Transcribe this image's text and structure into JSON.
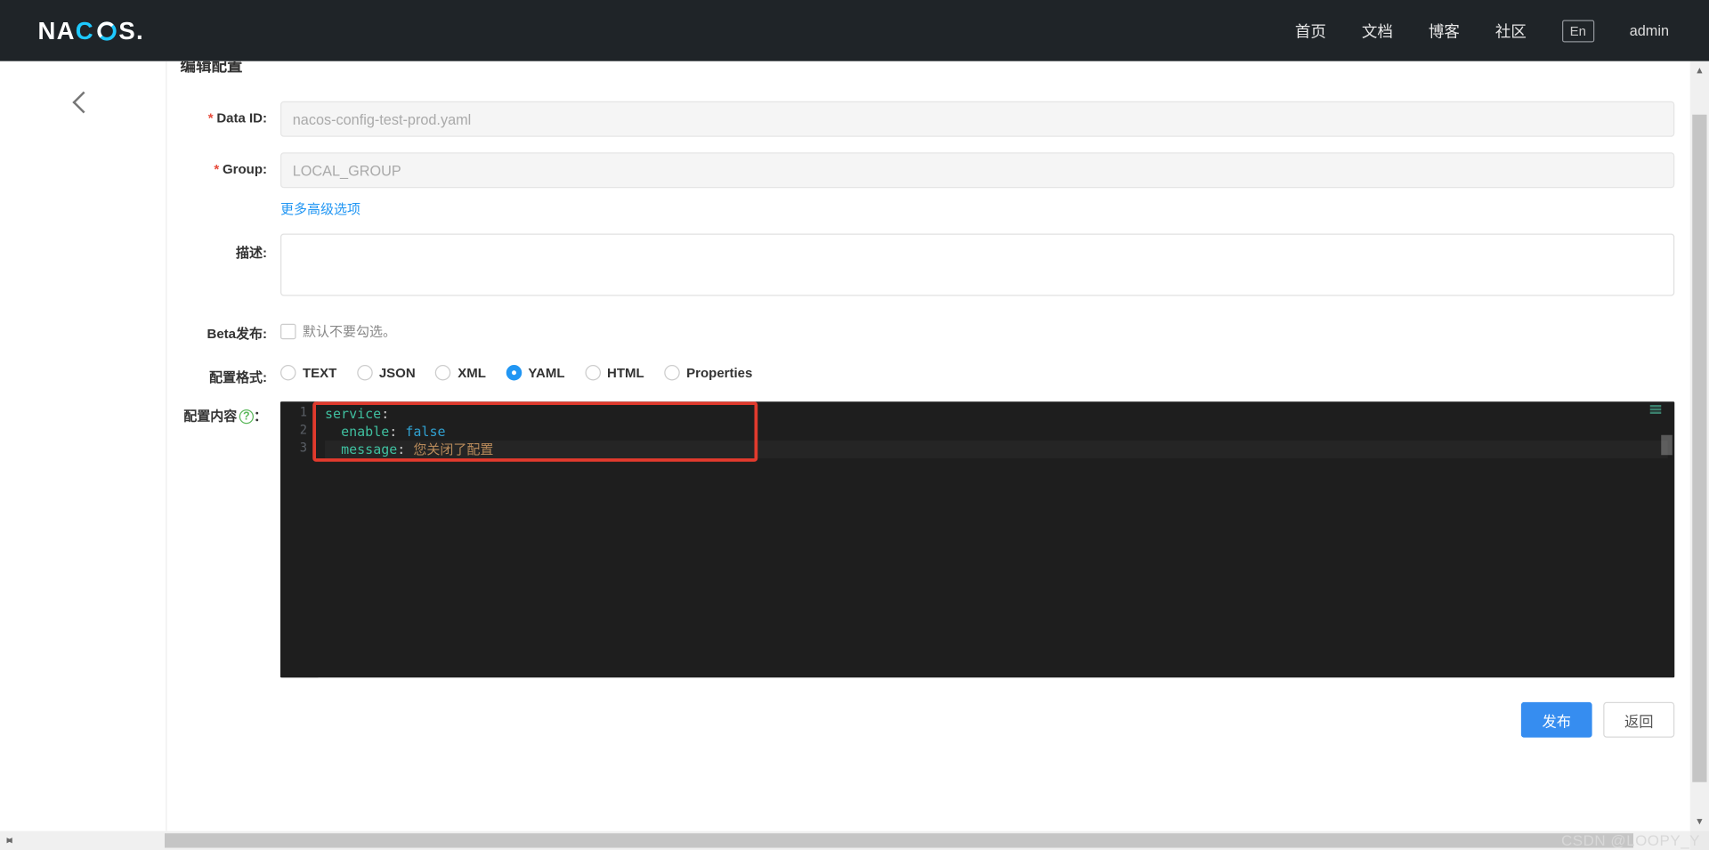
{
  "brand": "NACOS.",
  "nav": {
    "home": "首页",
    "docs": "文档",
    "blog": "博客",
    "community": "社区",
    "lang": "En",
    "user": "admin"
  },
  "page": {
    "title": "编辑配置"
  },
  "form": {
    "data_id_label": "Data ID:",
    "data_id_value": "nacos-config-test-prod.yaml",
    "group_label": "Group:",
    "group_value": "LOCAL_GROUP",
    "more_options": "更多高级选项",
    "desc_label": "描述:",
    "desc_value": "",
    "beta_label": "Beta发布:",
    "beta_hint": "默认不要勾选。",
    "format_label": "配置格式:",
    "content_label": "配置内容",
    "content_colon": "："
  },
  "formats": [
    {
      "label": "TEXT",
      "selected": false
    },
    {
      "label": "JSON",
      "selected": false
    },
    {
      "label": "XML",
      "selected": false
    },
    {
      "label": "YAML",
      "selected": true
    },
    {
      "label": "HTML",
      "selected": false
    },
    {
      "label": "Properties",
      "selected": false
    }
  ],
  "editor": {
    "gutter": [
      "1",
      "2",
      "3"
    ],
    "lines": [
      {
        "indent": "",
        "key": "service",
        "type": "key"
      },
      {
        "indent": "  ",
        "key": "enable",
        "value": "false",
        "vtype": "bool"
      },
      {
        "indent": "  ",
        "key": "message",
        "value": "您关闭了配置",
        "vtype": "str"
      }
    ]
  },
  "footer": {
    "publish": "发布",
    "back": "返回"
  },
  "watermark": "CSDN @LOOPY_Y"
}
